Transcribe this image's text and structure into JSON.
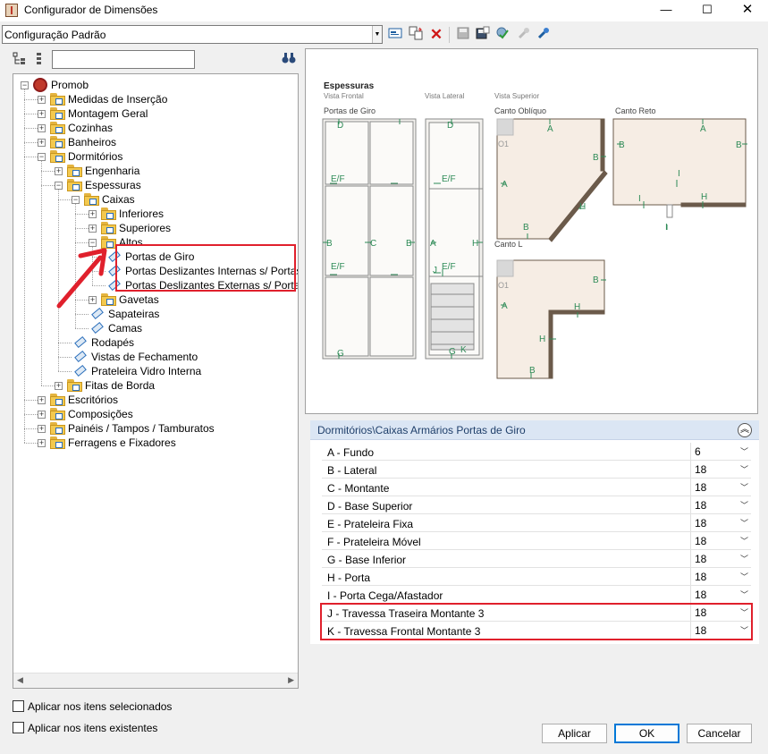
{
  "window": {
    "title": "Configurador de Dimensões",
    "minimize": "—",
    "maximize": "☐",
    "close": "✕"
  },
  "toolbar": {
    "configuration_value": "Configuração Padrão",
    "icons": [
      "form-icon",
      "copy-config-icon",
      "delete-icon",
      "save-icon",
      "save-as-icon",
      "validate-icon",
      "tool-icon",
      "pin-icon"
    ]
  },
  "tree": {
    "nodes": [
      {
        "label": "Promob",
        "level": 0,
        "type": "root",
        "expander": "−"
      },
      {
        "label": "Medidas de Inserção",
        "level": 1,
        "type": "folder",
        "expander": "+"
      },
      {
        "label": "Montagem Geral",
        "level": 1,
        "type": "folder",
        "expander": "+"
      },
      {
        "label": "Cozinhas",
        "level": 1,
        "type": "folder",
        "expander": "+"
      },
      {
        "label": "Banheiros",
        "level": 1,
        "type": "folder",
        "expander": "+"
      },
      {
        "label": "Dormitórios",
        "level": 1,
        "type": "folder",
        "expander": "−"
      },
      {
        "label": "Engenharia",
        "level": 2,
        "type": "folder",
        "expander": "+"
      },
      {
        "label": "Espessuras",
        "level": 2,
        "type": "folder",
        "expander": "−"
      },
      {
        "label": "Caixas",
        "level": 3,
        "type": "folder",
        "expander": "−"
      },
      {
        "label": "Inferiores",
        "level": 4,
        "type": "folder",
        "expander": "+"
      },
      {
        "label": "Superiores",
        "level": 4,
        "type": "folder",
        "expander": "+"
      },
      {
        "label": "Altos",
        "level": 4,
        "type": "folder",
        "expander": "−"
      },
      {
        "label": "Portas de Giro",
        "level": 5,
        "type": "item",
        "expander": ""
      },
      {
        "label": "Portas Deslizantes Internas s/ Portas",
        "level": 5,
        "type": "item",
        "expander": ""
      },
      {
        "label": "Portas Deslizantes Externas s/ Portas",
        "level": 5,
        "type": "item",
        "expander": ""
      },
      {
        "label": "Gavetas",
        "level": 4,
        "type": "folder",
        "expander": "+"
      },
      {
        "label": "Sapateiras",
        "level": 4,
        "type": "item",
        "expander": ""
      },
      {
        "label": "Camas",
        "level": 4,
        "type": "item",
        "expander": ""
      },
      {
        "label": "Rodapés",
        "level": 3,
        "type": "item",
        "expander": ""
      },
      {
        "label": "Vistas de Fechamento",
        "level": 3,
        "type": "item",
        "expander": ""
      },
      {
        "label": "Prateleira Vidro Interna",
        "level": 3,
        "type": "item",
        "expander": ""
      },
      {
        "label": "Fitas de Borda",
        "level": 2,
        "type": "folder",
        "expander": "+"
      },
      {
        "label": "Escritórios",
        "level": 1,
        "type": "folder",
        "expander": "+"
      },
      {
        "label": "Composições",
        "level": 1,
        "type": "folder",
        "expander": "+"
      },
      {
        "label": "Painéis / Tampos / Tamburatos",
        "level": 1,
        "type": "folder",
        "expander": "+"
      },
      {
        "label": "Ferragens e Fixadores",
        "level": 1,
        "type": "folder",
        "expander": "+"
      }
    ]
  },
  "options": {
    "apply_selected": "Aplicar nos itens selecionados",
    "apply_existing": "Aplicar nos itens existentes"
  },
  "preview": {
    "heading": "Espessuras",
    "view_front": "Vista Frontal",
    "view_side": "Vista Lateral",
    "view_top": "Vista Superior",
    "portas_giro": "Portas de Giro",
    "canto_obliquo": "Canto Oblíquo",
    "canto_reto": "Canto Reto",
    "canto_l": "Canto L",
    "marker_o1": "O1",
    "letters": {
      "a": "A",
      "b": "B",
      "c": "C",
      "d": "D",
      "ef": "E/F",
      "g": "G",
      "h": "H",
      "i": "I",
      "j": "J",
      "k": "K"
    }
  },
  "properties": {
    "title": "Dormitórios\\Caixas Armários Portas de Giro",
    "collapse_glyph": "︽",
    "rows": [
      {
        "name": "A - Fundo",
        "value": "6"
      },
      {
        "name": "B - Lateral",
        "value": "18"
      },
      {
        "name": "C - Montante",
        "value": "18"
      },
      {
        "name": "D - Base Superior",
        "value": "18"
      },
      {
        "name": "E - Prateleira Fixa",
        "value": "18"
      },
      {
        "name": "F - Prateleira Móvel",
        "value": "18"
      },
      {
        "name": "G - Base Inferior",
        "value": "18"
      },
      {
        "name": "H - Porta",
        "value": "18"
      },
      {
        "name": "I - Porta Cega/Afastador",
        "value": "18"
      },
      {
        "name": "J - Travessa Traseira Montante 3",
        "value": "18"
      },
      {
        "name": "K - Travessa Frontal Montante 3",
        "value": "18"
      }
    ]
  },
  "buttons": {
    "apply": "Aplicar",
    "ok": "OK",
    "cancel": "Cancelar"
  },
  "colors": {
    "highlight": "#e0202c",
    "header_bg": "#dbe6f4",
    "dimension_green": "#2e8b57",
    "panel_fill": "#f6ede4",
    "wall": "#6b5a4a"
  }
}
